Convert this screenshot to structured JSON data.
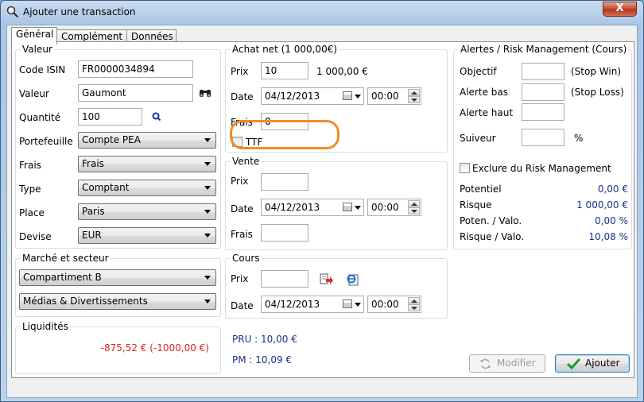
{
  "window": {
    "title": "Ajouter une transaction",
    "close_label": "X"
  },
  "tabs": [
    {
      "label": "Général"
    },
    {
      "label": "Complément"
    },
    {
      "label": "Données"
    }
  ],
  "valeur": {
    "title": "Valeur",
    "code_isin_label": "Code ISIN",
    "code_isin_value": "FR0000034894",
    "valeur_label": "Valeur",
    "valeur_value": "Gaumont",
    "quantite_label": "Quantité",
    "quantite_value": "100",
    "portefeuille_label": "Portefeuille",
    "portefeuille_value": "Compte PEA",
    "frais_label": "Frais",
    "frais_value": "Frais",
    "type_label": "Type",
    "type_value": "Comptant",
    "place_label": "Place",
    "place_value": "Paris",
    "devise_label": "Devise",
    "devise_value": "EUR"
  },
  "marche": {
    "title": "Marché et secteur",
    "compartiment_value": "Compartiment B",
    "secteur_value": "Médias & Divertissements"
  },
  "liquidites": {
    "title": "Liquidités",
    "value": "-875,52 € (-1000,00 €)"
  },
  "achat": {
    "title": "Achat net (1 000,00€)",
    "prix_label": "Prix",
    "prix_value": "10",
    "total_value": "1 000,00 €",
    "date_label": "Date",
    "date_value": "04/12/2013",
    "time_value": "00:00",
    "frais_label": "Frais",
    "frais_value": "0",
    "ttf_label": "TTF"
  },
  "vente": {
    "title": "Vente",
    "prix_label": "Prix",
    "prix_value": "",
    "date_label": "Date",
    "date_value": "04/12/2013",
    "time_value": "00:00",
    "frais_label": "Frais",
    "frais_value": ""
  },
  "cours": {
    "title": "Cours",
    "prix_label": "Prix",
    "prix_value": "",
    "date_label": "Date",
    "date_value": "04/12/2013",
    "time_value": "00:00"
  },
  "summary": {
    "pru": "PRU : 10,00 €",
    "pm": "PM : 10,09 €"
  },
  "alertes": {
    "title": "Alertes / Risk Management (Cours)",
    "objectif_label": "Objectif",
    "objectif_hint": "(Stop Win)",
    "alerte_bas_label": "Alerte bas",
    "alerte_bas_hint": "(Stop Loss)",
    "alerte_haut_label": "Alerte haut",
    "suiveur_label": "Suiveur",
    "suiveur_unit": "%",
    "exclure_label": "Exclure du Risk Management",
    "potentiel_label": "Potentiel",
    "potentiel_value": "0,00 €",
    "risque_label": "Risque",
    "risque_value": "1 000,00 €",
    "poten_valo_label": "Poten. / Valo.",
    "poten_valo_value": "0,00 %",
    "risque_valo_label": "Risque / Valo.",
    "risque_valo_value": "10,08 %"
  },
  "buttons": {
    "modifier": "Modifier",
    "ajouter": "Ajouter"
  },
  "colors": {
    "accent_blue": "#1a2f8a",
    "negative_red": "#e02020",
    "highlight_orange": "#f28c28"
  }
}
